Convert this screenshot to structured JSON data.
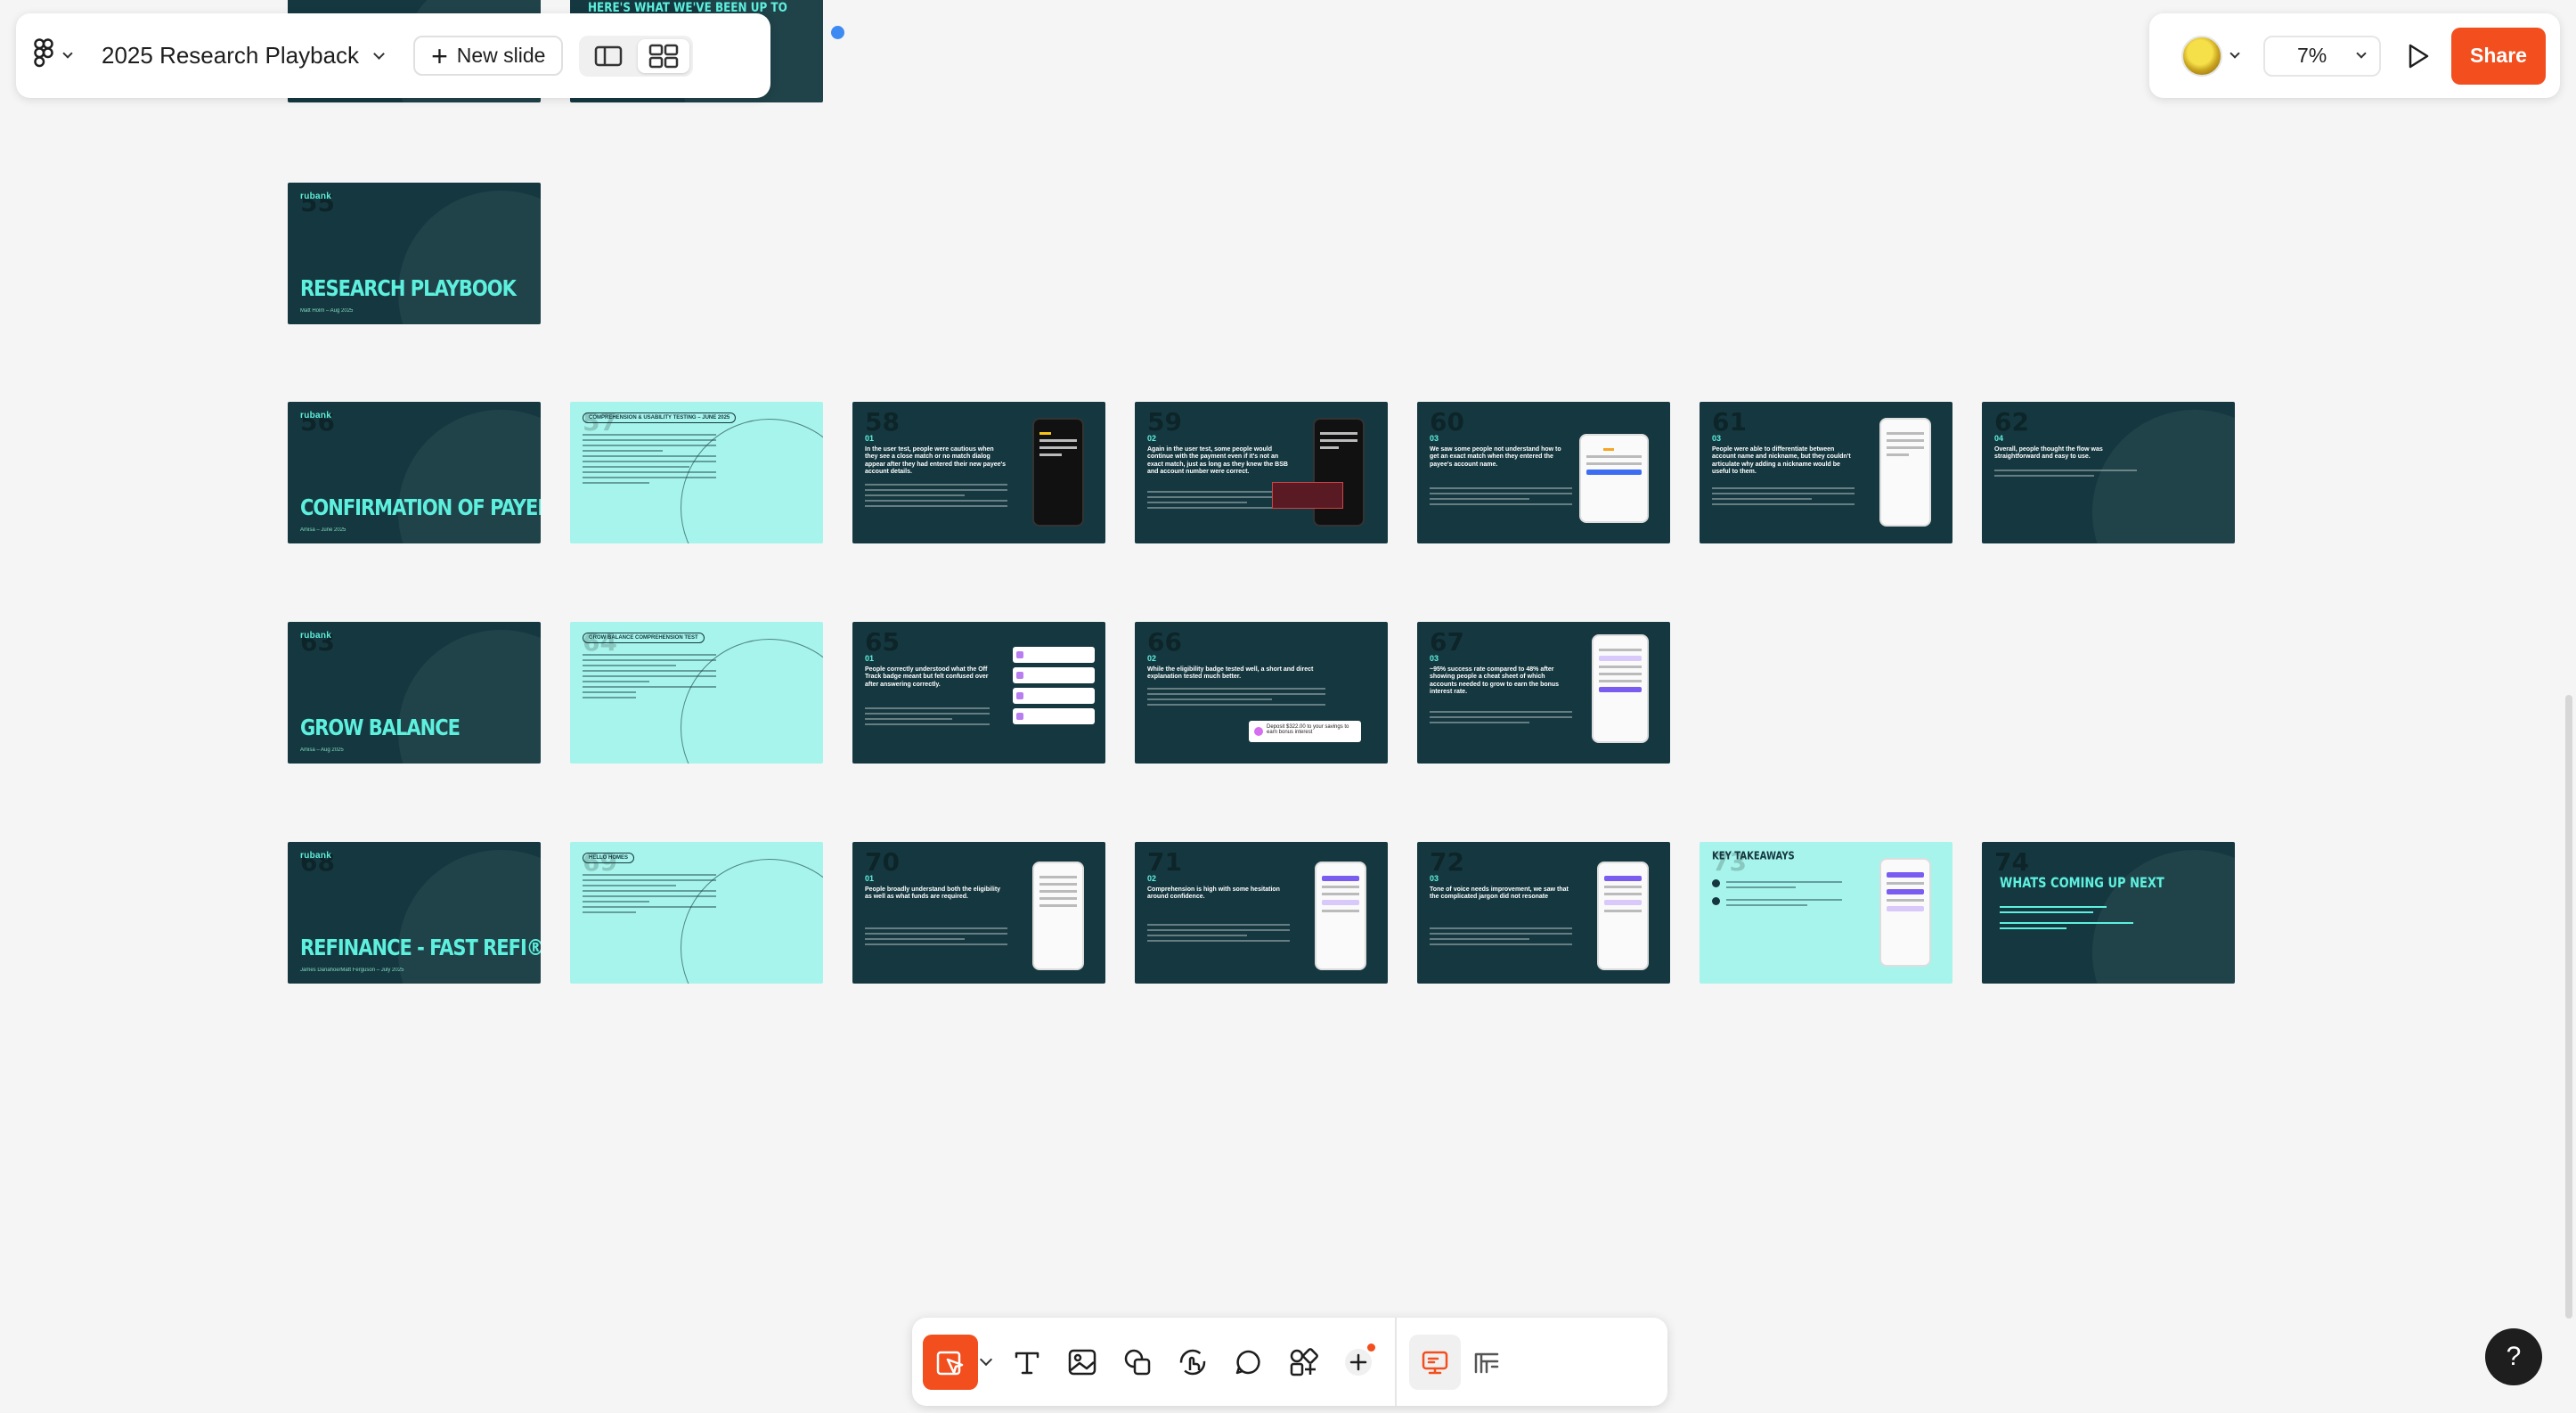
{
  "header": {
    "doc_title": "2025 Research Playback",
    "new_slide_label": "New slide"
  },
  "header_right": {
    "zoom_label": "7%",
    "share_label": "Share"
  },
  "help_label": "?",
  "slides": {
    "s_top1": {
      "title": ""
    },
    "s_top2": {
      "title": "HERE'S WHAT WE'VE BEEN UP TO"
    },
    "s55": {
      "num": "55",
      "logo": "rubank",
      "title": "RESEARCH PLAYBOOK",
      "sub": "Matt Holm – Aug 2025"
    },
    "s56": {
      "num": "56",
      "logo": "rubank",
      "title": "CONFIRMATION OF PAYEE",
      "sub": "Amisa – June 2025"
    },
    "s57": {
      "num": "57",
      "tag": "COMPREHENSION & USABILITY TESTING – JUNE 2025"
    },
    "s58": {
      "num": "58",
      "step": "01",
      "heading": "In the user test, people were cautious when they see a close match or no match dialog appear after they had entered their new payee's account details."
    },
    "s59": {
      "num": "59",
      "step": "02",
      "heading": "Again in the user test, some people would continue with the payment even if it's not an exact match, just as long as they knew the BSB and account number were correct."
    },
    "s60": {
      "num": "60",
      "step": "03",
      "heading": "We saw some people not understand how to get an exact match when they entered the payee's account name."
    },
    "s61": {
      "num": "61",
      "step": "03",
      "heading": "People were able to differentiate between account name and nickname, but they couldn't articulate why adding a nickname would be useful to them."
    },
    "s62": {
      "num": "62",
      "step": "04",
      "heading": "Overall, people thought the flow was straightforward and easy to use."
    },
    "s63": {
      "num": "63",
      "logo": "rubank",
      "title": "GROW BALANCE",
      "sub": "Amisa – Aug 2025"
    },
    "s64": {
      "num": "64",
      "tag": "GROW BALANCE COMPREHENSION TEST"
    },
    "s65": {
      "num": "65",
      "step": "01",
      "heading": "People correctly understood what the Off Track badge meant but felt confused over after answering correctly."
    },
    "s66": {
      "num": "66",
      "step": "02",
      "heading": "While the eligibility badge tested well, a short and direct explanation tested much better.",
      "toast": "Deposit $322.00 to your savings to earn bonus interest"
    },
    "s67": {
      "num": "67",
      "step": "03",
      "heading": "~95% success rate compared to 48% after showing people a cheat sheet of which accounts needed to grow to earn the bonus interest rate."
    },
    "s68": {
      "num": "68",
      "logo": "rubank",
      "title": "REFINANCE - FAST REFI®",
      "sub": "James Danahoe/Matt Ferguson – July 2025"
    },
    "s69": {
      "num": "69",
      "tag": "HELLO HOMES"
    },
    "s70": {
      "num": "70",
      "step": "01",
      "heading": "People broadly understand both the eligibility as well as what funds are required."
    },
    "s71": {
      "num": "71",
      "step": "02",
      "heading": "Comprehension is high with some hesitation around confidence."
    },
    "s72": {
      "num": "72",
      "step": "03",
      "heading": "Tone of voice needs improvement, we saw that the complicated jargon did not resonate"
    },
    "s73": {
      "num": "73",
      "title": "KEY TAKEAWAYS"
    },
    "s74": {
      "num": "74",
      "title": "WHATS COMING UP NEXT"
    }
  }
}
